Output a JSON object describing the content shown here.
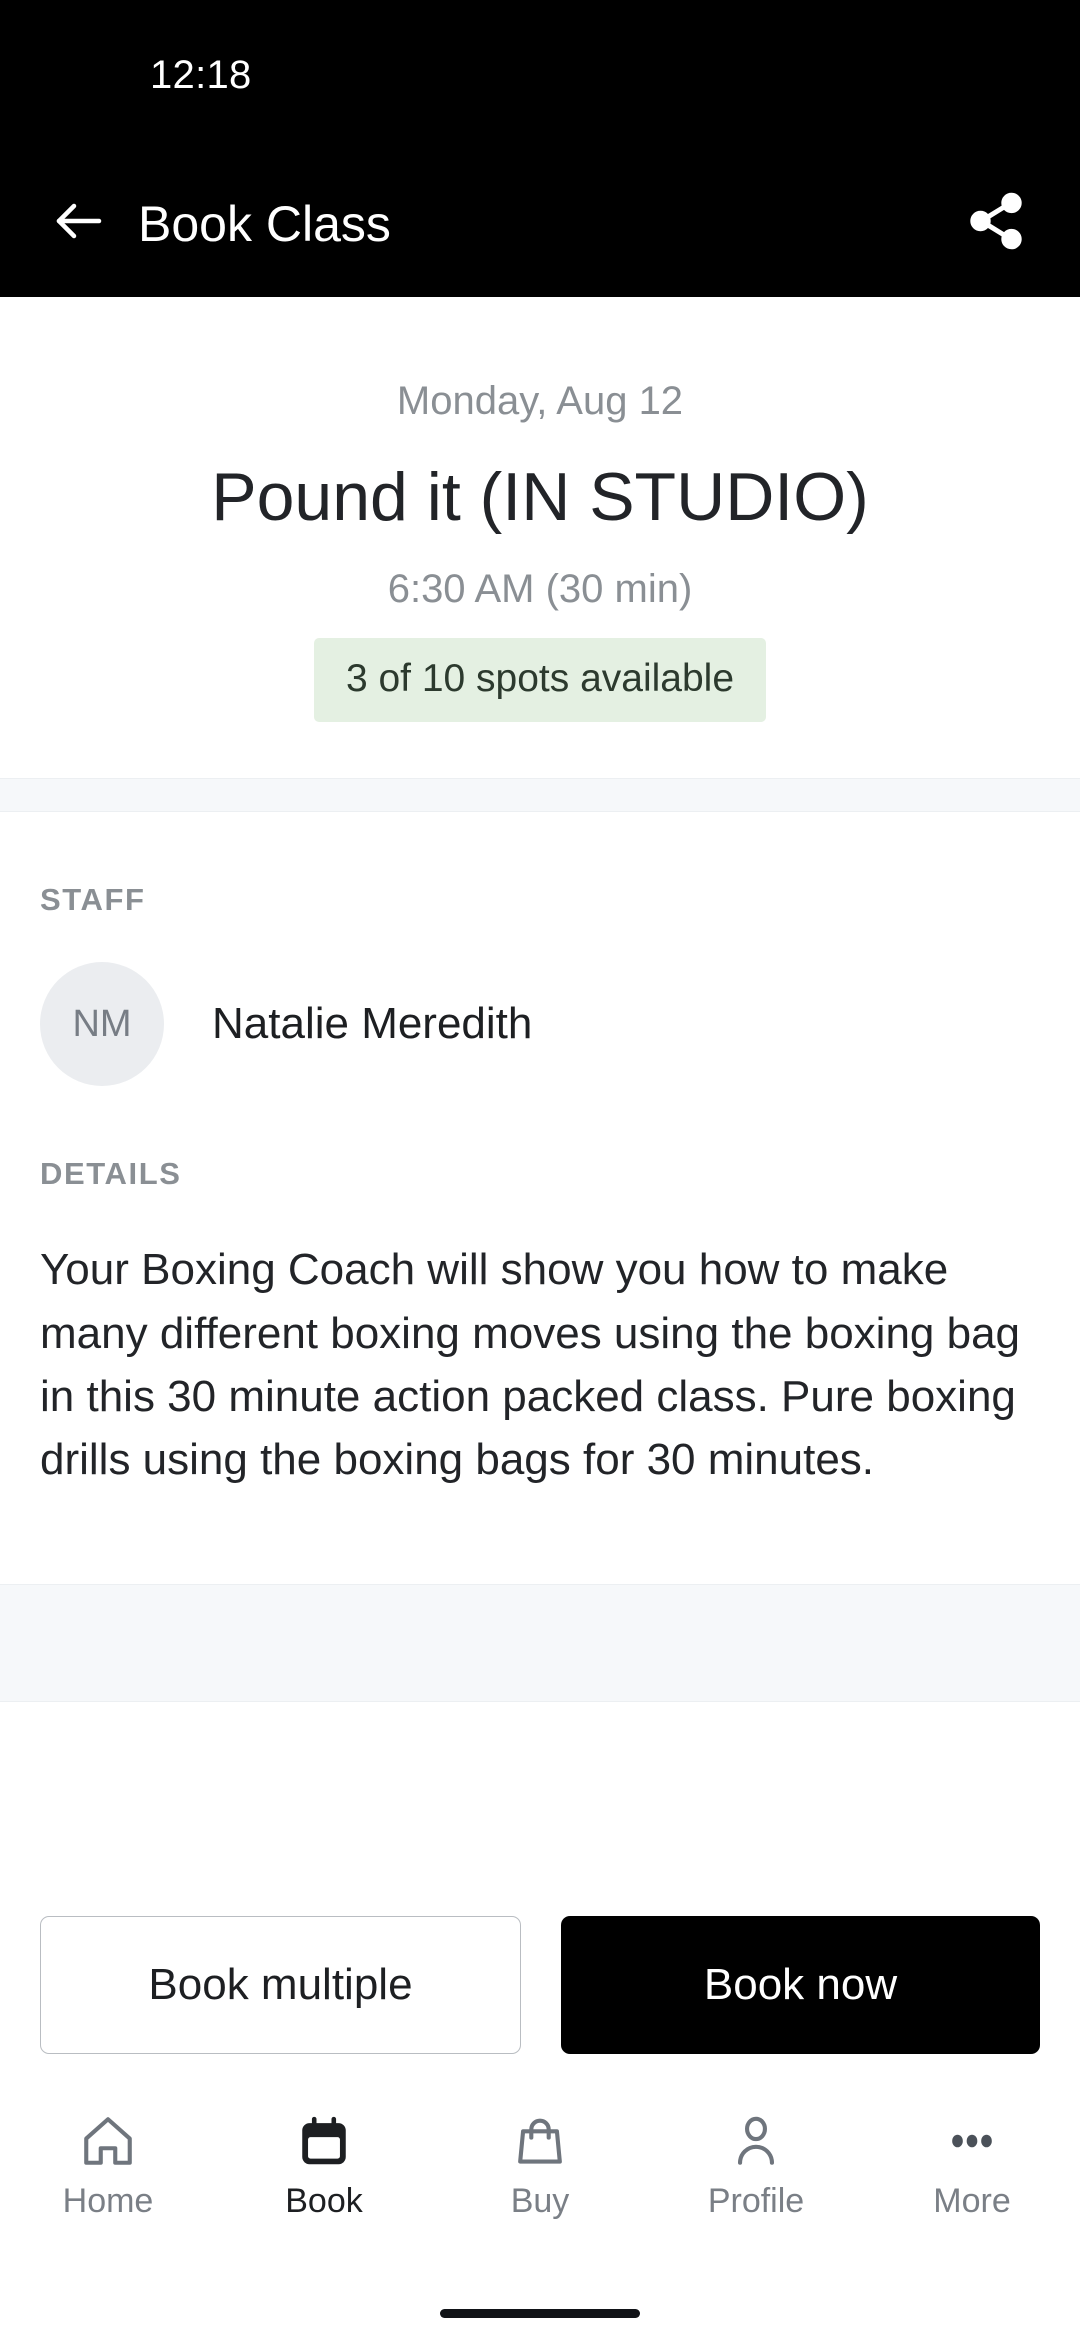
{
  "status_bar": {
    "clock": "12:18"
  },
  "app_bar": {
    "title": "Book Class",
    "back_icon": "arrow-left-icon",
    "share_icon": "share-icon"
  },
  "hero": {
    "date": "Monday, Aug 12",
    "class_name": "Pound it (IN STUDIO)",
    "time_and_duration": "6:30 AM (30 min)",
    "availability_badge": "3 of 10 spots available",
    "availability_badge_bg": "#e4f0e2",
    "availability_badge_text_color": "#2c3a2e"
  },
  "staff": {
    "section_label": "STAFF",
    "avatar_initials": "NM",
    "name": "Natalie Meredith"
  },
  "details": {
    "section_label": "DETAILS",
    "body": "Your Boxing Coach will show you how to make many different boxing moves using the boxing bag in this 30 minute action packed class. Pure boxing drills using the boxing bags for 30 minutes."
  },
  "actions": {
    "secondary_label": "Book multiple",
    "primary_label": "Book now",
    "primary_bg": "#000000",
    "primary_text_color": "#ffffff"
  },
  "bottom_nav": {
    "active_index": 1,
    "items": [
      {
        "label": "Home",
        "icon": "home-icon"
      },
      {
        "label": "Book",
        "icon": "calendar-icon"
      },
      {
        "label": "Buy",
        "icon": "shopping-bag-icon"
      },
      {
        "label": "Profile",
        "icon": "person-icon"
      },
      {
        "label": "More",
        "icon": "ellipsis-icon"
      }
    ]
  }
}
